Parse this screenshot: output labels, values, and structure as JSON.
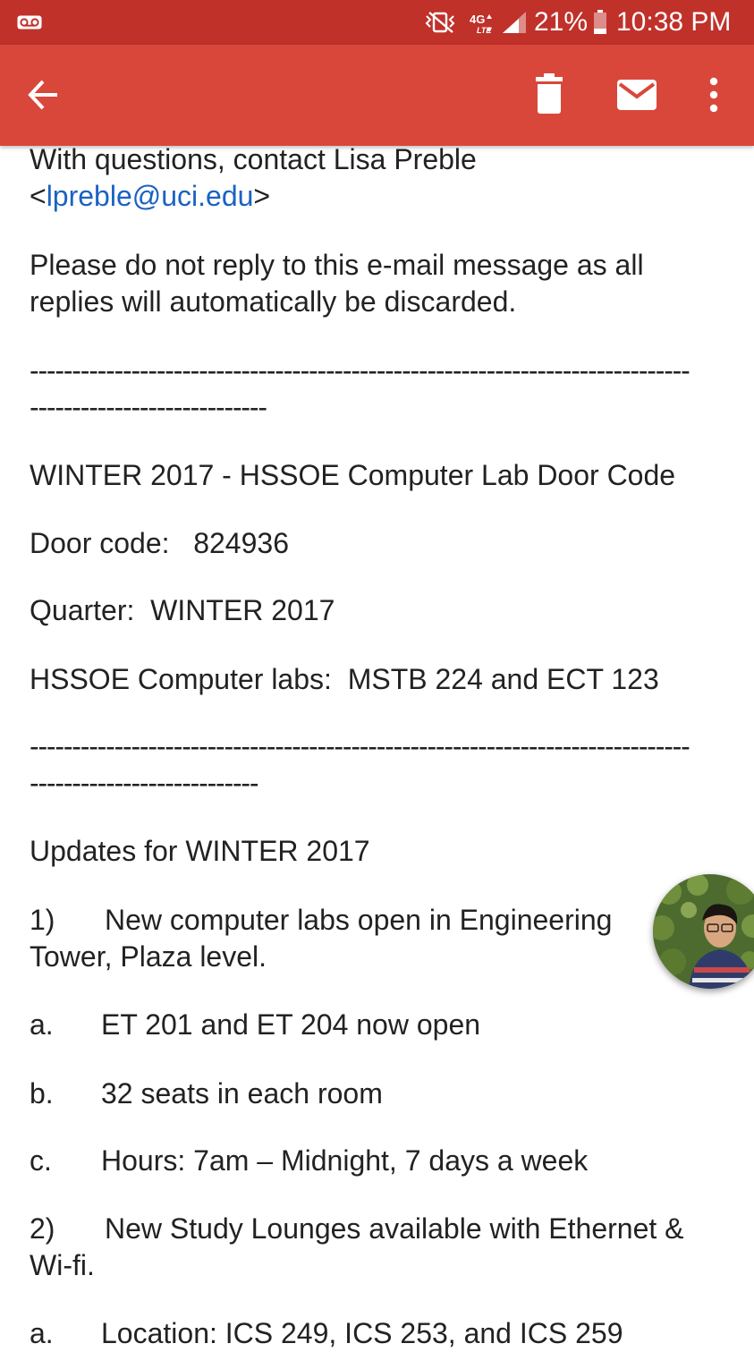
{
  "status_bar": {
    "battery_percent": "21%",
    "time": "10:38 PM",
    "network": "4G LTE",
    "icons": [
      "voicemail-icon",
      "mute-vibrate-icon",
      "lte-icon",
      "signal-icon",
      "battery-icon"
    ]
  },
  "app_bar": {
    "color": "#d9473b",
    "actions": [
      "back-arrow-icon",
      "delete-icon",
      "mark-unread-icon",
      "more-vert-icon"
    ]
  },
  "email": {
    "contact_line1": "With questions, contact Lisa Preble",
    "contact_lt": "<",
    "contact_email": "lpreble@uci.edu",
    "contact_gt": ">",
    "no_reply_1": "Please do not reply to this e-mail message as all",
    "no_reply_2": "replies will automatically be discarded.",
    "divider_1a": "------------------------------------------------------------------------------",
    "divider_1b": "----------------------------",
    "heading": "WINTER 2017 - HSSOE Computer Lab Door Code",
    "door_code_label": "Door code:",
    "door_code": "824936",
    "quarter_label": "Quarter:",
    "quarter": "WINTER 2017",
    "labs_label": "HSSOE Computer labs:",
    "labs": "MSTB 224 and ECT 123",
    "divider_2a": "------------------------------------------------------------------------------",
    "divider_2b": "---------------------------",
    "updates_heading": "Updates for WINTER 2017",
    "item1_num": "1)",
    "item1_text_1": "New computer labs open in Engineering",
    "item1_text_2": "Tower, Plaza level.",
    "item1a_label": "a.",
    "item1a_text": "ET 201 and ET 204 now open",
    "item1b_label": "b.",
    "item1b_text": "32 seats in each room",
    "item1c_label": "c.",
    "item1c_text": "Hours: 7am – Midnight, 7 days a week",
    "item2_num": "2)",
    "item2_text_1": "New Study Lounges available with Ethernet &",
    "item2_text_2": "Wi-fi.",
    "item2a_label": "a.",
    "item2a_text": "Location:  ICS 249, ICS 253, and ICS 259"
  }
}
